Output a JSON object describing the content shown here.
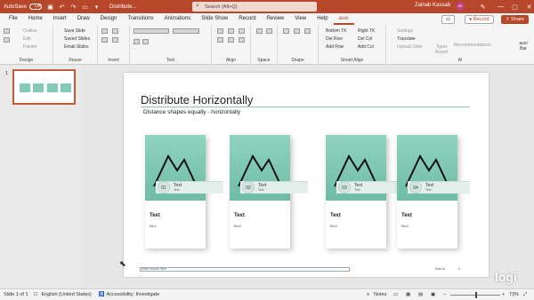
{
  "title_bar": {
    "autosave_label": "AutoSave",
    "autosave_state": "Off",
    "doc_title": "Distribute...",
    "search_placeholder": "Search (Alt+Q)",
    "user_name": "Zainab Kassab",
    "user_initials": "ZK"
  },
  "menu": {
    "tabs": [
      "File",
      "Home",
      "Insert",
      "Draw",
      "Design",
      "Transitions",
      "Animations",
      "Slide Show",
      "Record",
      "Review",
      "View",
      "Help",
      "auxi"
    ],
    "record_label": "Record",
    "share_label": "Share"
  },
  "ribbon": {
    "groups": [
      "Design",
      "Reuse",
      "Insert",
      "Text",
      "Align",
      "Space",
      "Shape",
      "Smart Align",
      "AI"
    ],
    "design_items": [
      "Outline",
      "Edit",
      "Painter"
    ],
    "reuse_items": [
      "Save Slide",
      "Saved Slides",
      "Email Slides"
    ],
    "smart_align_items": [
      "Bottom TK",
      "Right TK",
      "Del Row",
      "Del Col",
      "Add Row",
      "Add Col"
    ],
    "ai_items": [
      "Settings",
      "Translate",
      "Upload Slide",
      "Typer Based",
      "Recommendations",
      "auxi Bar"
    ]
  },
  "slide": {
    "title": "Distribute Horizontally",
    "subtitle": "Distance shapes equally - horizontally",
    "cards": [
      {
        "num": "01",
        "band_title": "Text",
        "band_sub": "Text",
        "title": "Text",
        "sub": "Bio1"
      },
      {
        "num": "02",
        "band_title": "Text",
        "band_sub": "Text",
        "title": "Text",
        "sub": "Bio2"
      },
      {
        "num": "03",
        "band_title": "Text",
        "band_sub": "Text",
        "title": "Text",
        "sub": "Bio3"
      },
      {
        "num": "04",
        "band_title": "Text",
        "band_sub": "Text",
        "title": "Text",
        "sub": "Bio4"
      }
    ],
    "footer_source": "Enter source here",
    "footer_mid": "Kahf Al",
    "page_number": "2"
  },
  "thumbnail": {
    "number": "1"
  },
  "status": {
    "slide_of": "Slide 1 of 1",
    "language": "English (United States)",
    "accessibility": "Accessibility: Investigate",
    "notes": "Notes",
    "zoom": "73%"
  },
  "watermark": "logi",
  "colors": {
    "accent": "#b7472a",
    "teal": "#83c9b7"
  }
}
